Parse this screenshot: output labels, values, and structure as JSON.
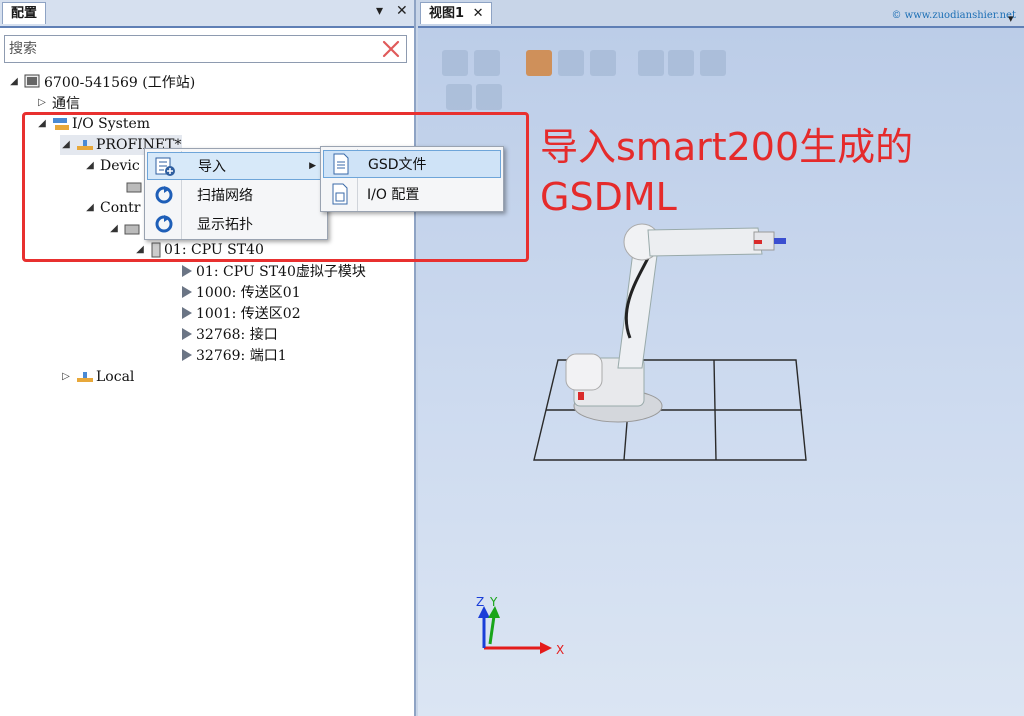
{
  "config_panel": {
    "tab_label": "配置",
    "pin_glyph": "▾",
    "close_glyph": "✕",
    "search_placeholder": "搜索",
    "tree": {
      "station": "6700-541569 (工作站)",
      "comm": "通信",
      "io_system": "I/O System",
      "profinet": "PROFINET*",
      "devices": "Devic",
      "controller": "Contr",
      "cpu": "01: CPU ST40",
      "items": [
        "01: CPU ST40虚拟子模块",
        "1000: 传送区01",
        "1001: 传送区02",
        "32768: 接口",
        "32769: 端口1"
      ],
      "local": "Local"
    }
  },
  "context_menu": {
    "items": [
      {
        "label": "导入",
        "icon": "import-list-icon",
        "has_submenu": true
      },
      {
        "label": "扫描网络",
        "icon": "refresh-icon"
      },
      {
        "label": "显示拓扑",
        "icon": "refresh-icon"
      }
    ],
    "submenu": [
      {
        "label": "GSD文件",
        "icon": "document-icon"
      },
      {
        "label": "I/O 配置",
        "icon": "config-file-icon"
      }
    ]
  },
  "view_panel": {
    "tab_label": "视图1",
    "close_glyph": "✕",
    "dropdown_glyph": "▾",
    "watermark": "© www.zuodianshier.net",
    "axes": {
      "x": "X",
      "y": "Y",
      "z": "Z"
    }
  },
  "annotation": {
    "line1": "导入smart200生成的",
    "line2": "GSDML",
    "color": "#e52b2b"
  }
}
